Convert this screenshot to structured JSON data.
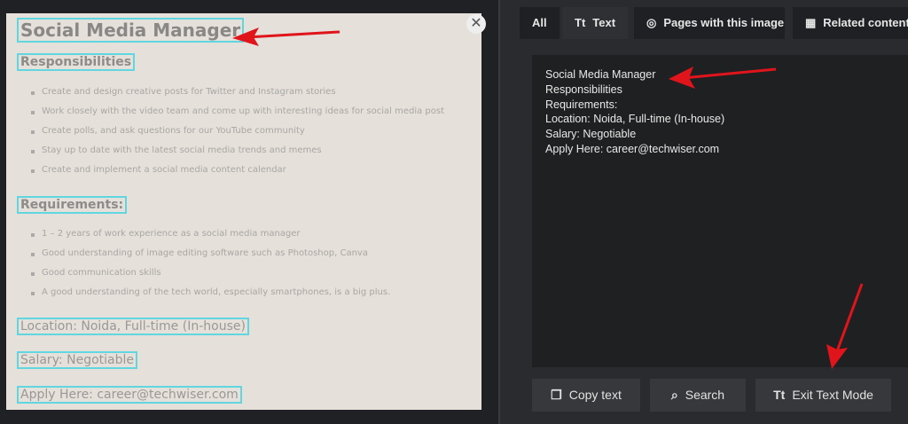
{
  "image": {
    "title": "Social Media Manager",
    "responsibilities_heading": "Responsibilities",
    "responsibilities": [
      "Create and design creative posts for Twitter and Instagram stories",
      "Work closely with the video team and come up with interesting ideas for social media post",
      "Create polls, and ask questions for our YouTube community",
      "Stay up to date with the latest social media trends and memes",
      "Create and implement a social media content calendar"
    ],
    "requirements_heading": "Requirements:",
    "requirements": [
      "1 – 2 years of work experience as a social media manager",
      "Good understanding of image editing software such as Photoshop, Canva",
      "Good communication skills",
      "A good understanding of the tech world, especially smartphones, is a big plus."
    ],
    "location": "Location: Noida, Full-time (In-house)",
    "salary": "Salary: Negotiable",
    "apply": "Apply Here: career@techwiser.com"
  },
  "tabs": [
    {
      "label": "All"
    },
    {
      "icon": "Tt",
      "label": "Text"
    },
    {
      "label": "Pages with this image"
    },
    {
      "label": "Related content"
    }
  ],
  "extracted_text": [
    "Social Media Manager",
    "Responsibilities",
    "Requirements:",
    "Location: Noida, Full-time (In-house)",
    "Salary: Negotiable",
    "Apply Here: career@techwiser.com"
  ],
  "buttons": {
    "copy": "Copy text",
    "search": "Search",
    "exit_icon": "Tt",
    "exit": "Exit Text Mode"
  },
  "colors": {
    "highlight": "#5fd6e0",
    "arrow": "#e0141b"
  }
}
